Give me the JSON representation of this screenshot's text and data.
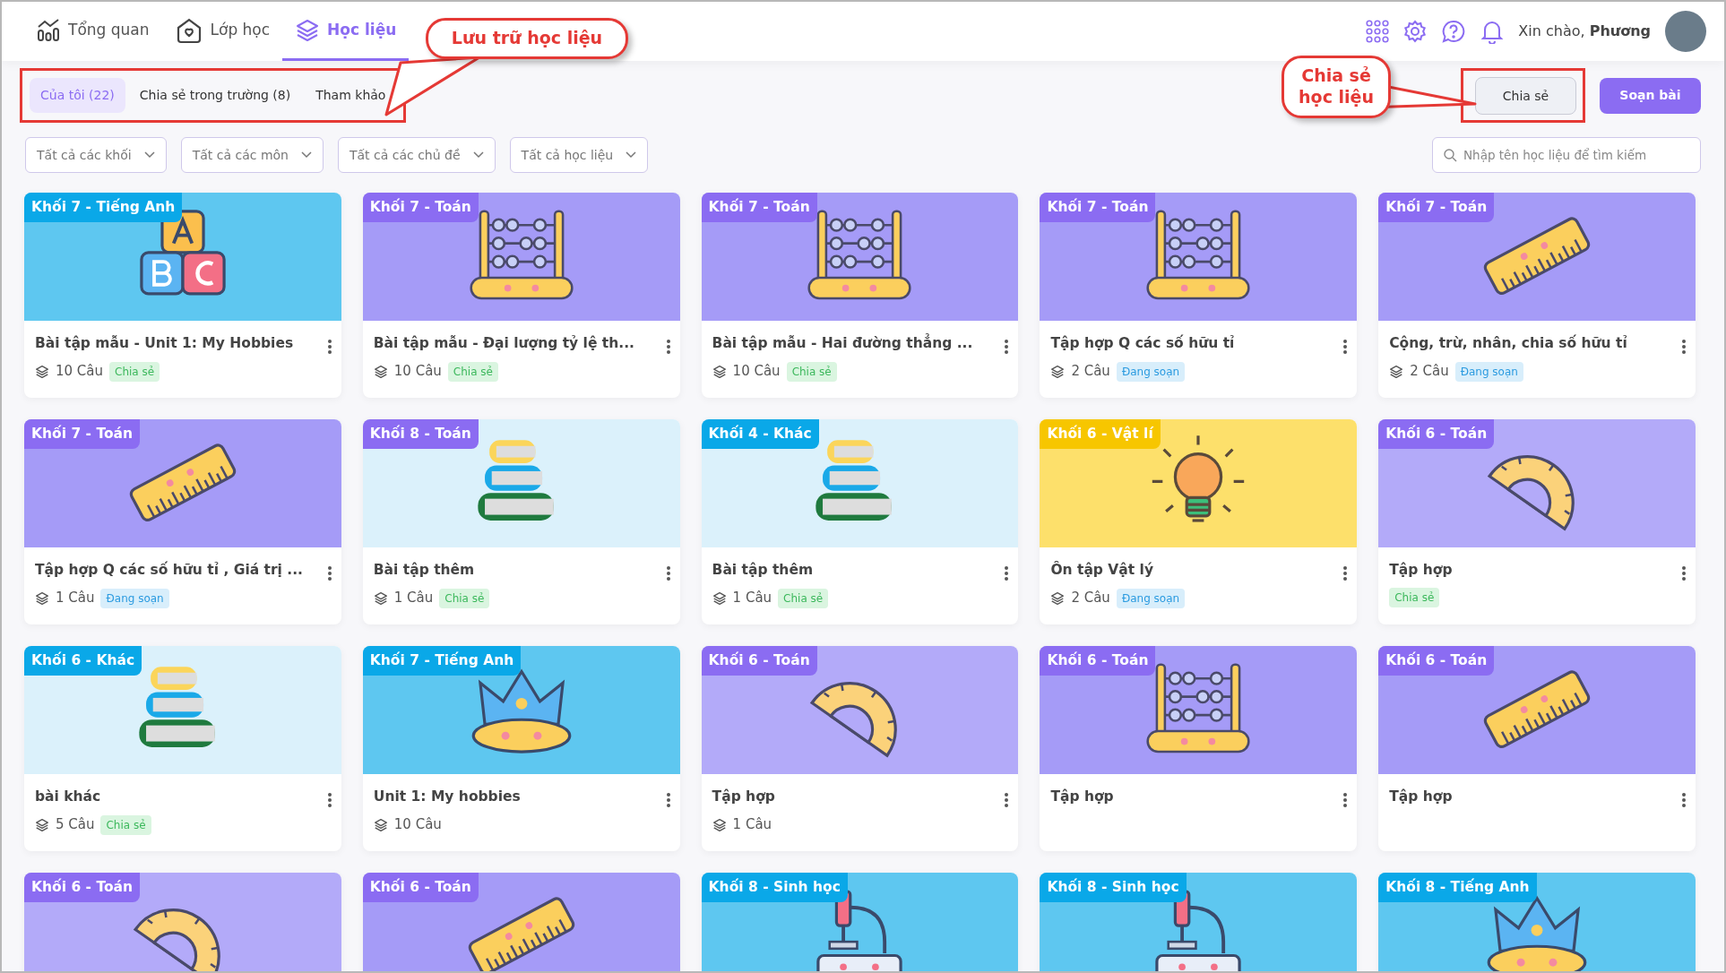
{
  "nav": {
    "items": [
      {
        "kind": "chart",
        "label": "Tổng quan",
        "selected": false
      },
      {
        "kind": "home",
        "label": "Lớp học",
        "selected": false
      },
      {
        "kind": "layers",
        "label": "Học liệu",
        "selected": true
      }
    ],
    "greeting": "Xin chào,",
    "user": "Phương"
  },
  "callouts": [
    {
      "text": "Lưu trữ học liệu",
      "kind": "tabs"
    },
    {
      "text": "Chia sẻ học liệu",
      "kind": "share"
    }
  ],
  "tabs": [
    {
      "label": "Của tôi (22)",
      "selected": true
    },
    {
      "label": "Chia sẻ trong trường (8)",
      "selected": false
    },
    {
      "label": "Tham khảo",
      "selected": false
    }
  ],
  "buttons": [
    {
      "label": "Chia sẻ",
      "kind": "secondary"
    },
    {
      "label": "Soạn bài",
      "kind": "primary"
    }
  ],
  "filters": [
    "Tất cả các khối",
    "Tất cả các môn",
    "Tất cả các chủ đề",
    "Tất cả học liệu"
  ],
  "search": {
    "placeholder": "Nhập tên học liệu để tìm kiếm"
  },
  "cards": [
    {
      "tag": "Khối 7 - Tiếng Anh",
      "color": "#0aa8e8",
      "kind": "abc",
      "title": "Bài tập mẫu - Unit 1: My Hobbies",
      "count": "10 Câu",
      "status": {
        "label": "Chia sẻ",
        "kind": "shared"
      }
    },
    {
      "tag": "Khối 7 - Toán",
      "color": "#8b6cf2",
      "kind": "abacus",
      "title": "Bài tập mẫu - Đại lượng tỷ lệ th...",
      "count": "10 Câu",
      "status": {
        "label": "Chia sẻ",
        "kind": "shared"
      }
    },
    {
      "tag": "Khối 7 - Toán",
      "color": "#8b6cf2",
      "kind": "abacus",
      "title": "Bài tập mẫu - Hai đường thẳng ...",
      "count": "10 Câu",
      "status": {
        "label": "Chia sẻ",
        "kind": "shared"
      }
    },
    {
      "tag": "Khối 7 - Toán",
      "color": "#8b6cf2",
      "kind": "abacus",
      "title": "Tập hợp Q các số hữu tỉ",
      "count": "2 Câu",
      "status": {
        "label": "Đang soạn",
        "kind": "draft"
      }
    },
    {
      "tag": "Khối 7 - Toán",
      "color": "#8b6cf2",
      "kind": "ruler",
      "title": "Cộng, trừ, nhân, chia số hữu tỉ",
      "count": "2 Câu",
      "status": {
        "label": "Đang soạn",
        "kind": "draft"
      }
    },
    {
      "tag": "Khối 7 - Toán",
      "color": "#8b6cf2",
      "kind": "ruler",
      "title": "Tập hợp Q các số hữu tỉ , Giá trị ...",
      "count": "1 Câu",
      "status": {
        "label": "Đang soạn",
        "kind": "draft"
      }
    },
    {
      "tag": "Khối 8 - Toán",
      "color": "#8b6cf2",
      "kind": "books",
      "title": "Bài tập thêm",
      "count": "1 Câu",
      "status": {
        "label": "Chia sẻ",
        "kind": "shared"
      }
    },
    {
      "tag": "Khối 4 - Khác",
      "color": "#0aa8e8",
      "kind": "books",
      "title": "Bài tập thêm",
      "count": "1 Câu",
      "status": {
        "label": "Chia sẻ",
        "kind": "shared"
      }
    },
    {
      "tag": "Khối 6 - Vật lí",
      "color": "#f7c600",
      "kind": "bulb",
      "title": "Ôn tập Vật lý",
      "count": "2 Câu",
      "status": {
        "label": "Đang soạn",
        "kind": "draft"
      }
    },
    {
      "tag": "Khối 6 - Toán",
      "color": "#8b6cf2",
      "kind": "protractor",
      "title": "Tập hợp",
      "status": {
        "label": "Chia sẻ",
        "kind": "shared"
      }
    },
    {
      "tag": "Khối 6 - Khác",
      "color": "#0aa8e8",
      "kind": "books",
      "title": "bài khác",
      "count": "5 Câu",
      "status": {
        "label": "Chia sẻ",
        "kind": "shared"
      }
    },
    {
      "tag": "Khối 7 - Tiếng Anh",
      "color": "#0aa8e8",
      "kind": "crown",
      "title": "Unit 1: My hobbies",
      "count": "10 Câu"
    },
    {
      "tag": "Khối 6 - Toán",
      "color": "#8b6cf2",
      "kind": "protractor",
      "title": "Tập hợp",
      "count": "1 Câu"
    },
    {
      "tag": "Khối 6 - Toán",
      "color": "#8b6cf2",
      "kind": "abacus",
      "title": "Tập hợp"
    },
    {
      "tag": "Khối 6 - Toán",
      "color": "#8b6cf2",
      "kind": "ruler",
      "title": "Tập hợp"
    },
    {
      "tag": "Khối 6 - Toán",
      "color": "#8b6cf2",
      "kind": "protractor"
    },
    {
      "tag": "Khối 6 - Toán",
      "color": "#8b6cf2",
      "kind": "ruler"
    },
    {
      "tag": "Khối 8 - Sinh học",
      "color": "#0aa8e8",
      "kind": "microscope"
    },
    {
      "tag": "Khối 8 - Sinh học",
      "color": "#0aa8e8",
      "kind": "microscope"
    },
    {
      "tag": "Khối 8 - Tiếng Anh",
      "color": "#0aa8e8",
      "kind": "crown"
    }
  ]
}
